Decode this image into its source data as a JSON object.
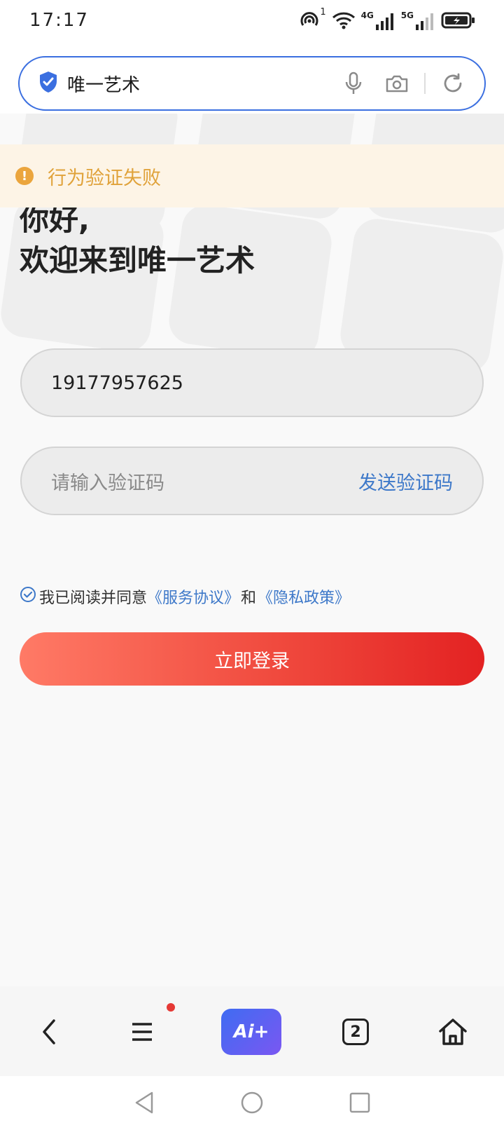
{
  "status_bar": {
    "time": "17:17",
    "net_4g": "4G",
    "net_5g": "5G",
    "hotspot_badge": "1"
  },
  "address_bar": {
    "title": "唯一艺术"
  },
  "page": {
    "warning_text": "行为验证失败",
    "warning_icon_glyph": "!",
    "greeting": "你好,",
    "welcome": "欢迎来到唯一艺术",
    "phone_value": "19177957625",
    "code_placeholder": "请输入验证码",
    "send_code_label": "发送验证码",
    "agree_prefix": "我已阅读并同意",
    "service_link": "《服务协议》",
    "agree_and": "和",
    "privacy_link": "《隐私政策》",
    "login_label": "立即登录"
  },
  "toolbar": {
    "ai_label": "Ai+",
    "tab_count": "2"
  },
  "colors": {
    "accent_blue": "#3b6fe0",
    "warning": "#e0a23a",
    "login_start": "#ff7a66",
    "login_end": "#e32222",
    "link": "#3d78c9"
  }
}
